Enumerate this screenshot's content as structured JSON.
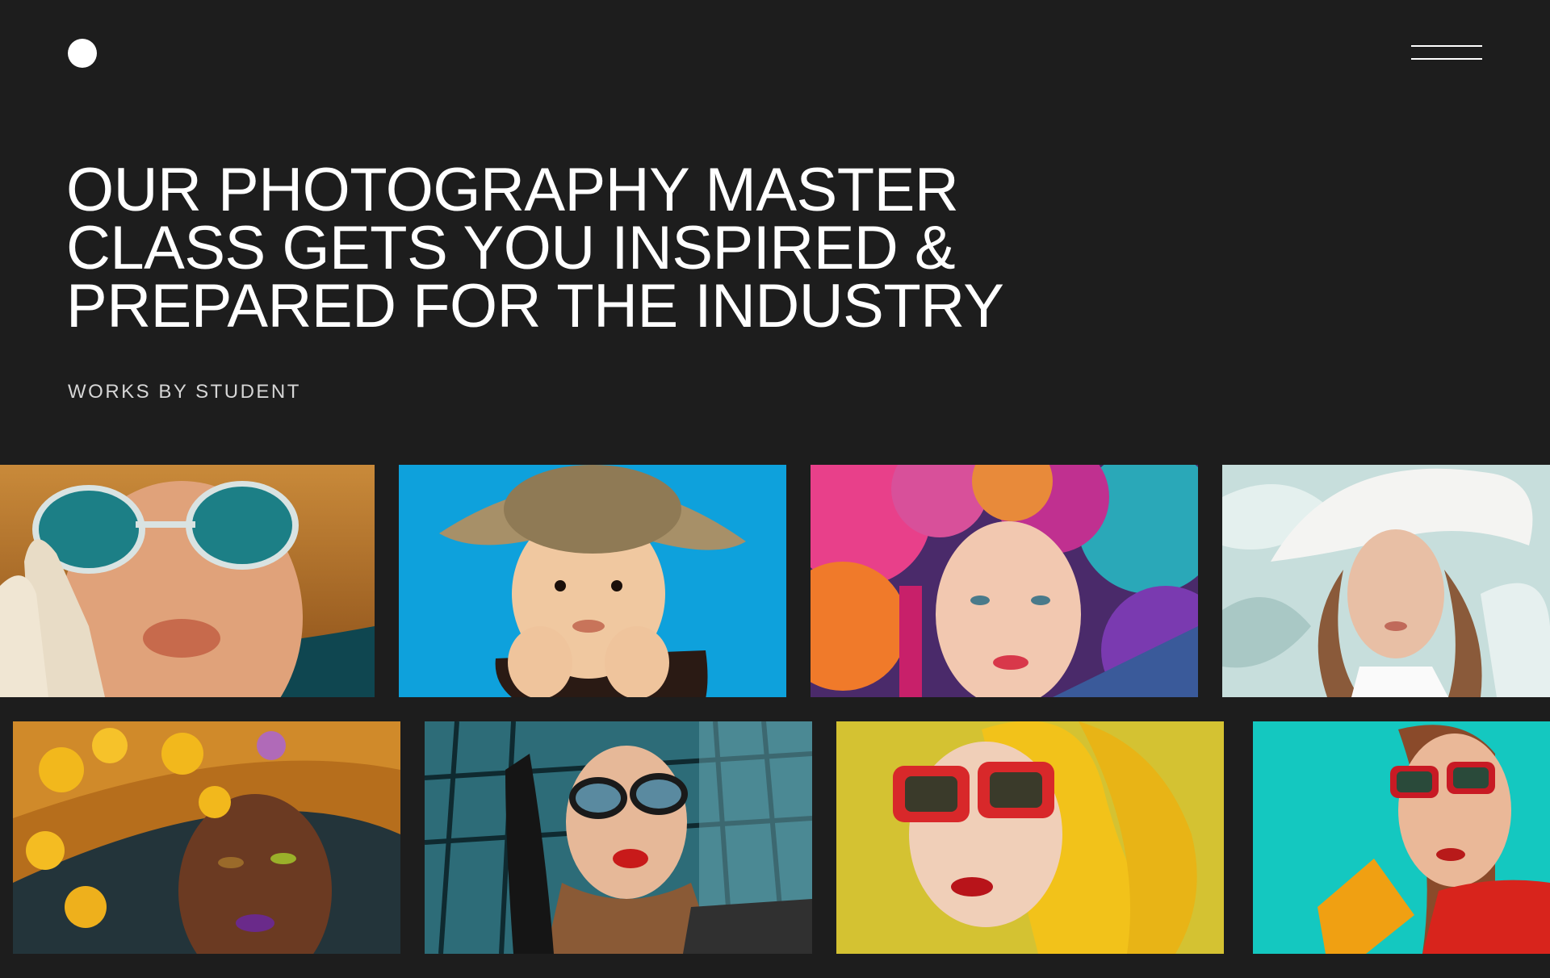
{
  "header": {
    "logo_icon": "circle-logo-icon",
    "menu_icon": "hamburger-menu-icon"
  },
  "hero": {
    "headline_lines": [
      "OUR PHOTOGRAPHY MASTER",
      "CLASS GETS YOU INSPIRED &",
      "PREPARED FOR THE INDUSTRY"
    ],
    "subheading": "WORKS BY STUDENT"
  },
  "gallery": {
    "rows": [
      [
        {
          "subject": "woman-teal-sunglasses-white-glove",
          "bg": "#b8741e"
        },
        {
          "subject": "child-straw-hat",
          "bg": "#10a0d8"
        },
        {
          "subject": "woman-colorful-feather-headdress",
          "bg": "#c8409a"
        },
        {
          "subject": "woman-white-hat-silk",
          "bg": "#c7dedc"
        }
      ],
      [
        {
          "subject": "woman-orchid-straw-hat",
          "bg": "#c0781a"
        },
        {
          "subject": "woman-leopard-scarf-sunglasses",
          "bg": "#3b8a9a"
        },
        {
          "subject": "woman-yellow-headwrap-red-glasses",
          "bg": "#d8c63a"
        },
        {
          "subject": "woman-red-sunglasses-snack",
          "bg": "#12c8c0"
        }
      ]
    ]
  },
  "colors": {
    "background": "#1d1d1d",
    "text": "#ffffff",
    "subtext": "#d6d6d6"
  }
}
